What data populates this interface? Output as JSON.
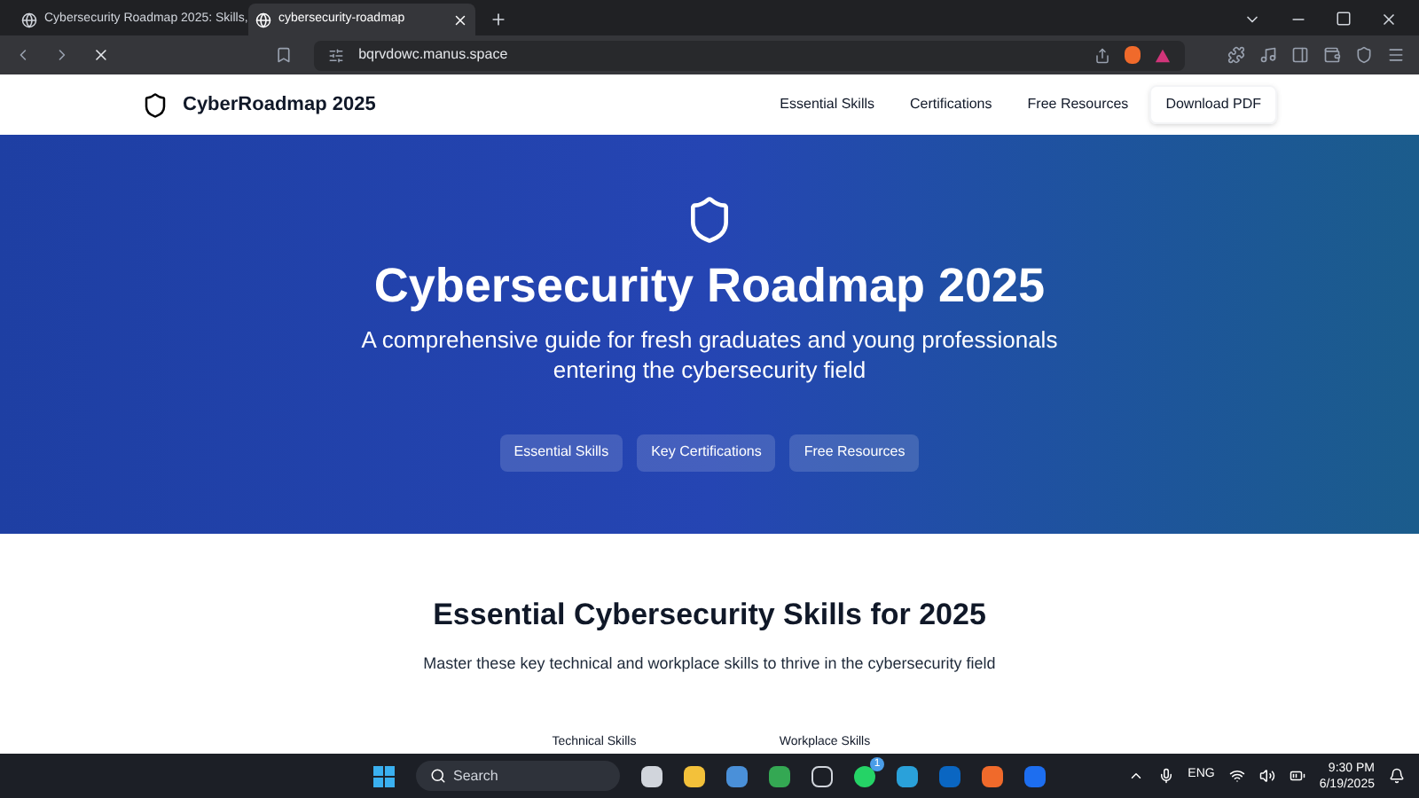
{
  "browser": {
    "tabs": [
      {
        "title": "Cybersecurity Roadmap 2025: Skills,",
        "selected": false
      },
      {
        "title": "cybersecurity-roadmap",
        "selected": true
      }
    ],
    "address": "bqrvdowc.manus.space"
  },
  "site": {
    "brand": "CyberRoadmap 2025",
    "nav": [
      {
        "label": "Essential Skills",
        "kind": "link"
      },
      {
        "label": "Certifications",
        "kind": "link"
      },
      {
        "label": "Free Resources",
        "kind": "link"
      },
      {
        "label": "Download PDF",
        "kind": "button"
      }
    ]
  },
  "hero": {
    "title": "Cybersecurity Roadmap 2025",
    "subtitle": "A comprehensive guide for fresh graduates and young professionals entering the cybersecurity field",
    "buttons": [
      "Essential Skills",
      "Key Certifications",
      "Free Resources"
    ]
  },
  "skills": {
    "title": "Essential Cybersecurity Skills for 2025",
    "subtitle": "Master these key technical and workplace skills to thrive in the cybersecurity field",
    "tabs": [
      {
        "label": "Technical Skills",
        "selected": false
      },
      {
        "label": "Workplace Skills",
        "selected": false
      }
    ]
  },
  "taskbar": {
    "search": "Search",
    "badge": "1",
    "language": "ENG",
    "time": "9:30 PM",
    "date": "6/19/2025"
  }
}
